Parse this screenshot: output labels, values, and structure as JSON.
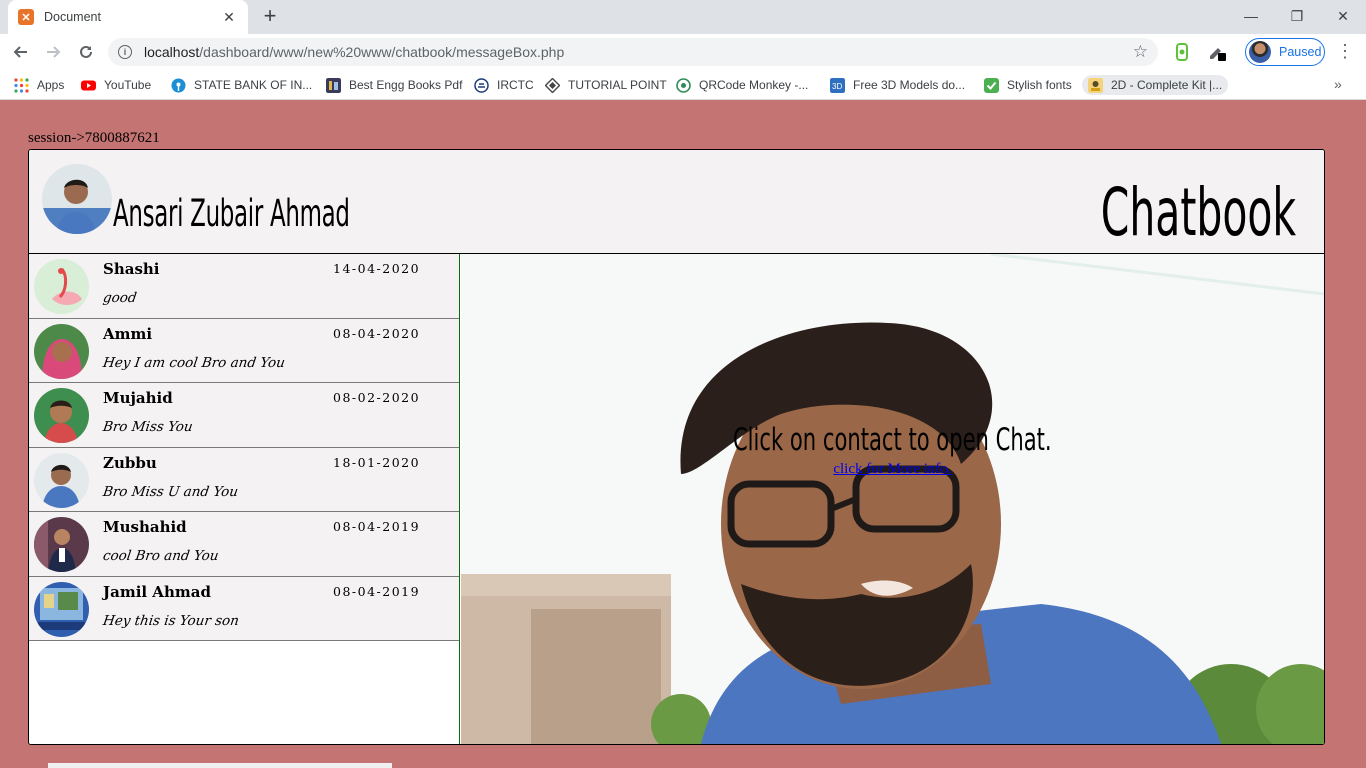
{
  "browser": {
    "tab_title": "Document",
    "tab_close": "✕",
    "new_tab": "+",
    "url_host": "localhost",
    "url_path": "/dashboard/www/new%20www/chatbook/messageBox.php",
    "profile_status": "Paused",
    "window_controls": [
      "—",
      "❐",
      "✕"
    ]
  },
  "bookmarks": [
    {
      "label": "Apps",
      "icon": "apps-grid-icon",
      "color": "#ea4335"
    },
    {
      "label": "YouTube",
      "icon": "youtube-icon",
      "color": "#ff0000"
    },
    {
      "label": "STATE BANK OF IN...",
      "icon": "sbi-icon",
      "color": "#1a8fd6"
    },
    {
      "label": "Best Engg Books Pdf",
      "icon": "books-icon",
      "color": "#3a3a5a"
    },
    {
      "label": "IRCTC",
      "icon": "irctc-icon",
      "color": "#1d3b7a"
    },
    {
      "label": "TUTORIAL POINT",
      "icon": "tutorialpoint-icon",
      "color": "#444444"
    },
    {
      "label": "QRCode Monkey -...",
      "icon": "qrcode-icon",
      "color": "#2e8b57"
    },
    {
      "label": "Free 3D Models do...",
      "icon": "3d-icon",
      "color": "#2f6fbf"
    },
    {
      "label": "Stylish fonts",
      "icon": "check-shield-icon",
      "color": "#4caf50"
    },
    {
      "label": "2D - Complete Kit |...",
      "icon": "kit-icon",
      "color": "#d4a017"
    }
  ],
  "page": {
    "session_text": "session->7800887621",
    "user_name": "Ansari Zubair Ahmad",
    "app_title": "Chatbook",
    "prompt": "Click on contact to open Chat.",
    "more_link": "click for More info."
  },
  "contacts": [
    {
      "name": "Shashi",
      "date": "14-04-2020",
      "message": "good"
    },
    {
      "name": "Ammi",
      "date": "08-04-2020",
      "message": "Hey I am cool Bro and You"
    },
    {
      "name": "Mujahid",
      "date": "08-02-2020",
      "message": "Bro Miss You"
    },
    {
      "name": "Zubbu",
      "date": "18-01-2020",
      "message": "Bro Miss U and You"
    },
    {
      "name": "Mushahid",
      "date": "08-04-2019",
      "message": "cool Bro and You"
    },
    {
      "name": "Jamil Ahmad",
      "date": "08-04-2019",
      "message": "Hey this is Your son"
    }
  ],
  "colors": {
    "page_background": "#c47472",
    "panel_background": "#f4f2f3",
    "divider": "#0b6b0b",
    "link": "#0000ee"
  }
}
